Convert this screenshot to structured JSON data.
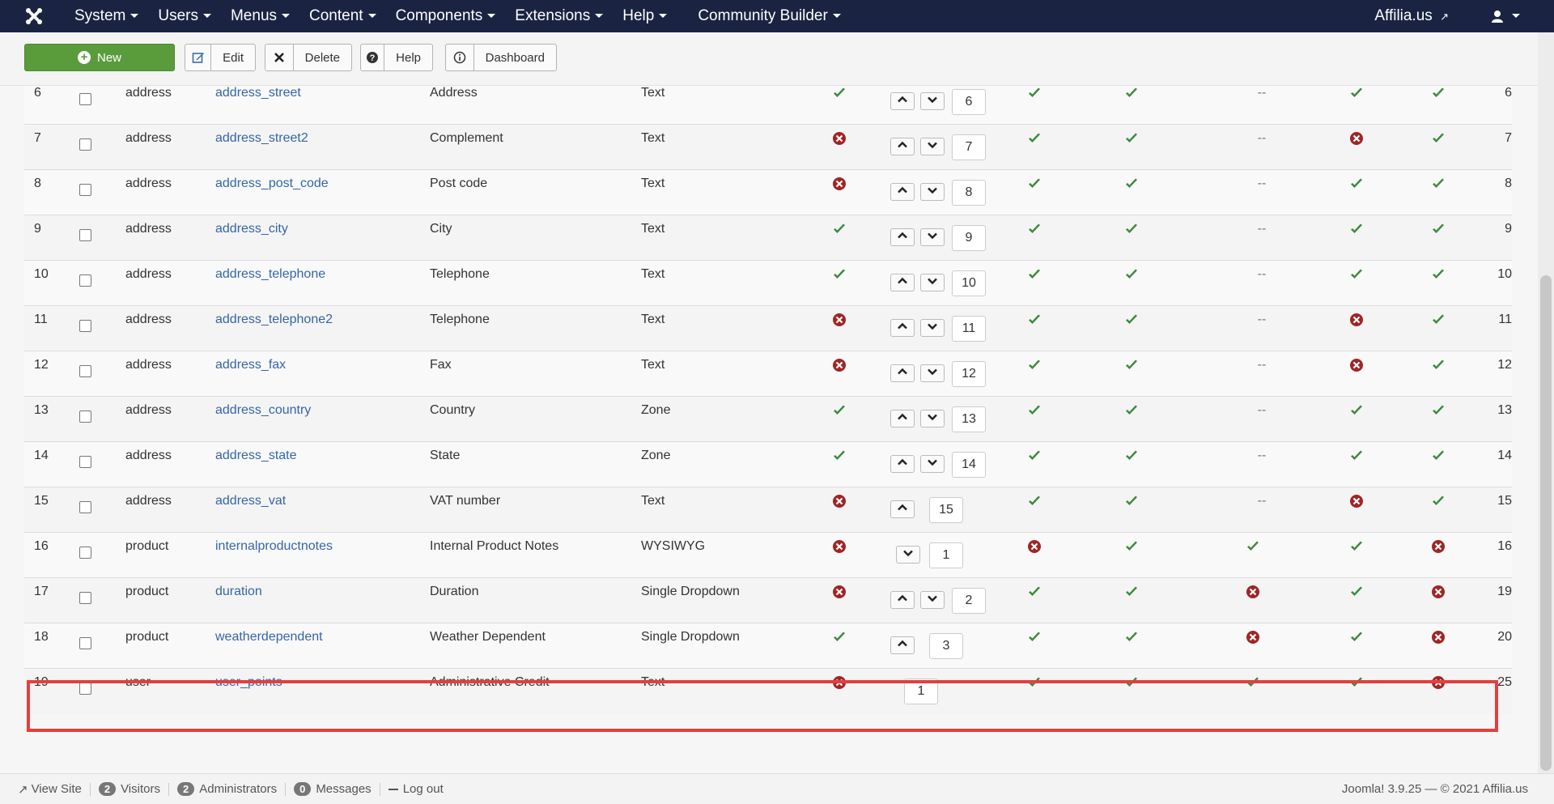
{
  "nav": {
    "items": [
      "System",
      "Users",
      "Menus",
      "Content",
      "Components",
      "Extensions",
      "Help",
      "Community Builder"
    ],
    "site_link": "Affilia.us"
  },
  "toolbar": {
    "new_label": "New",
    "edit_label": "Edit",
    "delete_label": "Delete",
    "help_label": "Help",
    "dashboard_label": "Dashboard"
  },
  "rows": [
    {
      "id": "6",
      "section": "address",
      "name": "address_street",
      "title": "Address",
      "type": "Text",
      "required": "yes",
      "up": true,
      "down": true,
      "order": "6",
      "published": "yes",
      "registration": "yes",
      "profile": "--",
      "searchable": "yes",
      "list": "yes",
      "rid": "6"
    },
    {
      "id": "7",
      "section": "address",
      "name": "address_street2",
      "title": "Complement",
      "type": "Text",
      "required": "no",
      "up": true,
      "down": true,
      "order": "7",
      "published": "yes",
      "registration": "yes",
      "profile": "--",
      "searchable": "no",
      "list": "yes",
      "rid": "7"
    },
    {
      "id": "8",
      "section": "address",
      "name": "address_post_code",
      "title": "Post code",
      "type": "Text",
      "required": "no",
      "up": true,
      "down": true,
      "order": "8",
      "published": "yes",
      "registration": "yes",
      "profile": "--",
      "searchable": "yes",
      "list": "yes",
      "rid": "8"
    },
    {
      "id": "9",
      "section": "address",
      "name": "address_city",
      "title": "City",
      "type": "Text",
      "required": "yes",
      "up": true,
      "down": true,
      "order": "9",
      "published": "yes",
      "registration": "yes",
      "profile": "--",
      "searchable": "yes",
      "list": "yes",
      "rid": "9"
    },
    {
      "id": "10",
      "section": "address",
      "name": "address_telephone",
      "title": "Telephone",
      "type": "Text",
      "required": "yes",
      "up": true,
      "down": true,
      "order": "10",
      "published": "yes",
      "registration": "yes",
      "profile": "--",
      "searchable": "yes",
      "list": "yes",
      "rid": "10"
    },
    {
      "id": "11",
      "section": "address",
      "name": "address_telephone2",
      "title": "Telephone",
      "type": "Text",
      "required": "no",
      "up": true,
      "down": true,
      "order": "11",
      "published": "yes",
      "registration": "yes",
      "profile": "--",
      "searchable": "no",
      "list": "yes",
      "rid": "11"
    },
    {
      "id": "12",
      "section": "address",
      "name": "address_fax",
      "title": "Fax",
      "type": "Text",
      "required": "no",
      "up": true,
      "down": true,
      "order": "12",
      "published": "yes",
      "registration": "yes",
      "profile": "--",
      "searchable": "no",
      "list": "yes",
      "rid": "12"
    },
    {
      "id": "13",
      "section": "address",
      "name": "address_country",
      "title": "Country",
      "type": "Zone",
      "required": "yes",
      "up": true,
      "down": true,
      "order": "13",
      "published": "yes",
      "registration": "yes",
      "profile": "--",
      "searchable": "yes",
      "list": "yes",
      "rid": "13"
    },
    {
      "id": "14",
      "section": "address",
      "name": "address_state",
      "title": "State",
      "type": "Zone",
      "required": "yes",
      "up": true,
      "down": true,
      "order": "14",
      "published": "yes",
      "registration": "yes",
      "profile": "--",
      "searchable": "yes",
      "list": "yes",
      "rid": "14"
    },
    {
      "id": "15",
      "section": "address",
      "name": "address_vat",
      "title": "VAT number",
      "type": "Text",
      "required": "no",
      "up": true,
      "down": false,
      "order": "15",
      "published": "yes",
      "registration": "yes",
      "profile": "--",
      "searchable": "no",
      "list": "yes",
      "rid": "15"
    },
    {
      "id": "16",
      "section": "product",
      "name": "internalproductnotes",
      "title": "Internal Product Notes",
      "type": "WYSIWYG",
      "required": "no",
      "up": false,
      "down": true,
      "order": "1",
      "published": "no",
      "registration": "yes",
      "profile": "yes",
      "searchable": "yes",
      "list": "no",
      "rid": "16"
    },
    {
      "id": "17",
      "section": "product",
      "name": "duration",
      "title": "Duration",
      "type": "Single Dropdown",
      "required": "no",
      "up": true,
      "down": true,
      "order": "2",
      "published": "yes",
      "registration": "yes",
      "profile": "no",
      "searchable": "yes",
      "list": "no",
      "rid": "19"
    },
    {
      "id": "18",
      "section": "product",
      "name": "weatherdependent",
      "title": "Weather Dependent",
      "type": "Single Dropdown",
      "required": "yes",
      "up": true,
      "down": false,
      "order": "3",
      "published": "yes",
      "registration": "yes",
      "profile": "no",
      "searchable": "yes",
      "list": "no",
      "rid": "20"
    },
    {
      "id": "19",
      "section": "user",
      "name": "user_points",
      "title": "Administrative Credit",
      "type": "Text",
      "required": "no",
      "up": false,
      "down": false,
      "order": "1",
      "published": "yes",
      "registration": "yes",
      "profile": "yes",
      "searchable": "yes",
      "list": "no",
      "rid": "25"
    }
  ],
  "status": {
    "view_site": "View Site",
    "visitors_count": "2",
    "visitors_label": "Visitors",
    "admins_count": "2",
    "admins_label": "Administrators",
    "messages_count": "0",
    "messages_label": "Messages",
    "logout_label": "Log out",
    "version": "Joomla! 3.9.25 — © 2021 Affilia.us"
  },
  "colors": {
    "navbar": "#1a2442",
    "new_button": "#5a9c3c",
    "link": "#3565a8",
    "check": "#3c8a3c",
    "cross": "#a02525",
    "highlight": "#e53e3e"
  }
}
